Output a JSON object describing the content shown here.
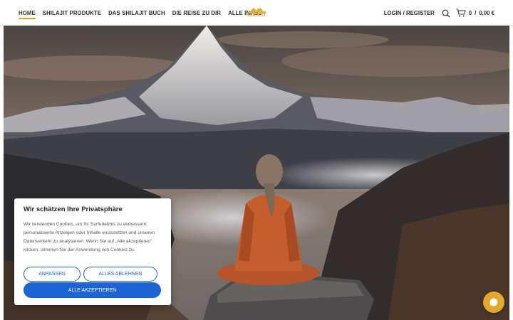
{
  "nav": {
    "items": [
      {
        "label": "HOME",
        "active": true
      },
      {
        "label": "SHILAJIT PRODUKTE"
      },
      {
        "label": "DAS SHILAJIT BUCH"
      },
      {
        "label": "DIE REISE ZU DIR"
      },
      {
        "label": "ALLE INFOS"
      }
    ]
  },
  "logo": {
    "text": "SHILAJIT"
  },
  "account": {
    "login_label": "LOGIN / REGISTER"
  },
  "cart": {
    "count": "0",
    "separator": "/",
    "total": "0,00 €"
  },
  "cookie": {
    "title": "Wir schätzen Ihre Privatsphäre",
    "body": "Wir verwenden Cookies, um Ihr Surferlebnis zu verbessern, personalisierte Anzeigen oder Inhalte einzusetzen und unseren Datenverkehr zu analysieren. Wenn Sie auf „Alle akzeptieren\" klicken, stimmen Sie der Anwendung von Cookies zu.",
    "customize_label": "ANPASSEN",
    "reject_label": "ALLES ABLEHNEN",
    "accept_label": "ALLE AKZEPTIEREN"
  },
  "colors": {
    "accent": "#e0a52a",
    "primary_button": "#1d63d8",
    "chat_button": "#e5a82e"
  },
  "icons": {
    "search": "search-icon",
    "cart": "cart-icon",
    "chat": "chat-icon"
  }
}
